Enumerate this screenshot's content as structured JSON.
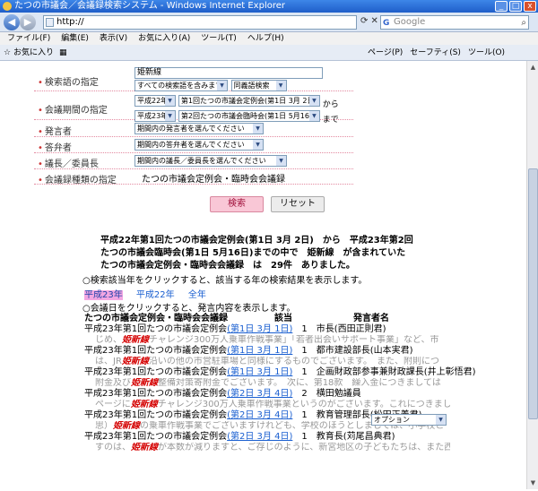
{
  "window": {
    "title": "たつの市議会／会議録検索システム - Windows Internet Explorer",
    "minimize": "_",
    "maximize": "□",
    "close": "x"
  },
  "address": {
    "url": "http://",
    "search_placeholder": "Google"
  },
  "menu": [
    "ファイル(F)",
    "編集(E)",
    "表示(V)",
    "お気に入り(A)",
    "ツール(T)",
    "ヘルプ(H)"
  ],
  "favbar": {
    "favorites": "お気に入り",
    "tools": [
      "ページ(P)",
      "セーフティ(S)",
      "ツール(O)"
    ]
  },
  "form": {
    "keyword_label": "検索語の指定",
    "keyword_value": "姫新線",
    "keyword_mode": "すべての検索語を含みます",
    "keyword_synonym": "同義語検索",
    "period_label": "会議期間の指定",
    "period_from_year": "平成22年",
    "period_from_meeting": "第1回たつの市議会定例会(第1日 3月 2日)",
    "period_from_suffix": "から",
    "period_to_year": "平成23年",
    "period_to_meeting": "第2回たつの市議会臨時会(第1日 5月16日)",
    "period_to_suffix": "まで",
    "speaker_label": "発言者",
    "speaker_value": "期間内の発言者を選んでください",
    "answerer_label": "答弁者",
    "answerer_value": "期間内の答弁者を選んでください",
    "chair_label": "議長／委員長",
    "chair_value": "期間内の議長／委員長を選んでください",
    "type_label": "会議録種類の指定",
    "type_value": "たつの市議会定例会・臨時会会議録",
    "search_button": "検索",
    "reset_button": "リセット"
  },
  "summary": {
    "line1": "平成22年第1回たつの市議会定例会(第1日 3月 2日)　から　平成23年第2回",
    "line2": "たつの市議会臨時会(第1日 5月16日)までの中で　姫新線　が含まれていた",
    "line3": "たつの市議会定例会・臨時会会議録　は　29件　ありました。"
  },
  "year_hint": "○検索該当年をクリックすると、該当する年の検索結果を表示します。",
  "years": [
    "平成23年",
    "平成22年",
    "全年"
  ],
  "date_hint": "○会議日をクリックすると、発言内容を表示します。",
  "table_header": {
    "col1": "たつの市議会定例会・臨時会会議録",
    "col2": "該当",
    "col3": "発言者名"
  },
  "results": [
    {
      "meeting": "平成23年第1回たつの市議会定例会",
      "date": "(第1日 3月 1日)",
      "count": "1",
      "speaker": "市長(西田正則君)",
      "pre": "じめ、",
      "hl": "姫新線",
      "post": "チャレンジ300万人乗車作戦事業」「若者出会いサポート事業」など、市"
    },
    {
      "meeting": "平成23年第1回たつの市議会定例会",
      "date": "(第1日 3月 1日)",
      "count": "1",
      "speaker": "都市建設部長(山本実君)",
      "pre": "は、JR",
      "hl": "姫新線",
      "post": "沿いの他の市営駐車場と同様にするものでございます。　また、附則につ"
    },
    {
      "meeting": "平成23年第1回たつの市議会定例会",
      "date": "(第1日 3月 1日)",
      "count": "1",
      "speaker": "企画財政部参事兼財政課長(井上彰悟君)",
      "pre": "附金及び",
      "hl": "姫新線",
      "post": "整備対策寄附金でございます。　次に、第18款　繰入金につきましては"
    },
    {
      "meeting": "平成23年第1回たつの市議会定例会",
      "date": "(第2日 3月 4日)",
      "count": "2",
      "speaker": "横田勉議員",
      "pre": "ページに",
      "hl": "姫新線",
      "post": "チャレンジ300万人乗車作戦事業というのがございます。これにつきまし"
    },
    {
      "meeting": "平成23年第1回たつの市議会定例会",
      "date": "(第2日 3月 4日)",
      "count": "1",
      "speaker": "教育管理部長(松田正義君)",
      "pre": "思）",
      "hl": "姫新線",
      "post": "の乗車作戦事業でございますけれども、学校のほうとしましては、小学校と"
    },
    {
      "meeting": "平成23年第1回たつの市議会定例会",
      "date": "(第2日 3月 4日)",
      "count": "1",
      "speaker": "教育長(苅尾昌典君)",
      "pre": "すのは、",
      "hl": "姫新線",
      "post": "が本数が減りますと、ご存じのように、新宮地区の子どもたちは、また西栗"
    }
  ],
  "options_select": "オプション"
}
